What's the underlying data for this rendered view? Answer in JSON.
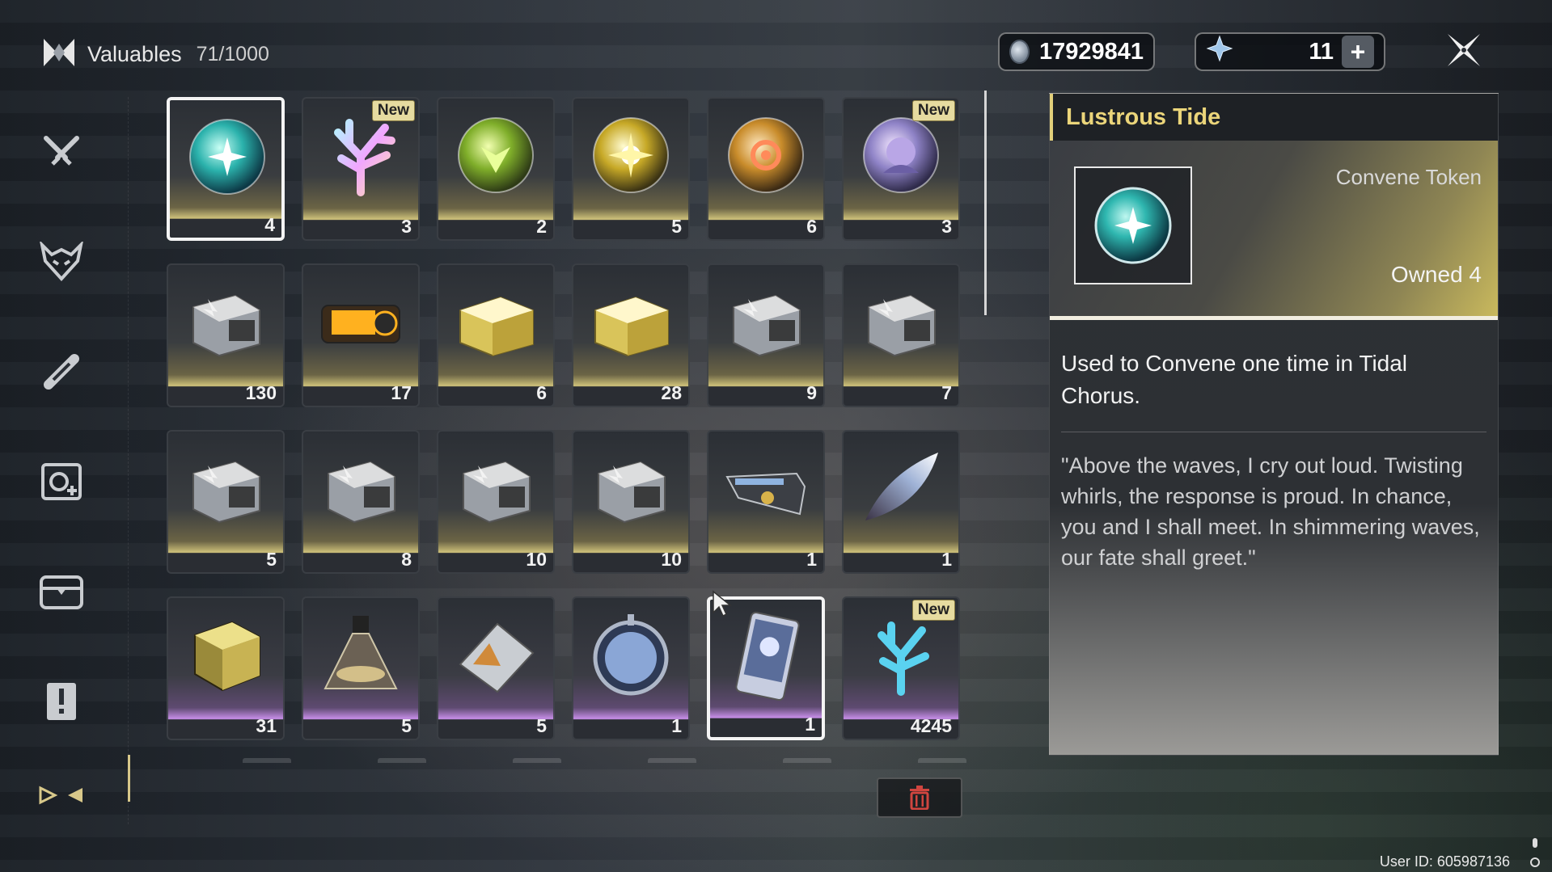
{
  "header": {
    "title": "Valuables",
    "capacity": "71/1000",
    "currency_primary": "17929841",
    "currency_secondary": "11"
  },
  "sidebar": {
    "items": [
      {
        "name": "weapons-tab",
        "icon": "crossed-swords-icon"
      },
      {
        "name": "echoes-tab",
        "icon": "demon-mask-icon"
      },
      {
        "name": "upgrade-materials-tab",
        "icon": "material-tab-icon"
      },
      {
        "name": "development-tab",
        "icon": "development-icon"
      },
      {
        "name": "supplies-tab",
        "icon": "chest-icon"
      },
      {
        "name": "quest-items-tab",
        "icon": "exclamation-icon"
      },
      {
        "name": "valuables-tab",
        "icon": "valuables-icon"
      }
    ]
  },
  "items": [
    {
      "name": "Lustrous Tide",
      "count": "4",
      "kind": "orb-teal",
      "new": "",
      "selected": true
    },
    {
      "name": "coral-pink",
      "count": "3",
      "kind": "coral-pink",
      "new": "New"
    },
    {
      "name": "orb-green",
      "count": "2",
      "kind": "orb-green",
      "new": ""
    },
    {
      "name": "orb-yellow",
      "count": "5",
      "kind": "orb-yellow",
      "new": ""
    },
    {
      "name": "orb-orange",
      "count": "6",
      "kind": "orb-orange",
      "new": ""
    },
    {
      "name": "character-orb",
      "count": "3",
      "kind": "orb-portrait",
      "new": "New"
    },
    {
      "name": "echo-crate",
      "count": "130",
      "kind": "crate-silver",
      "new": ""
    },
    {
      "name": "orange-crate",
      "count": "17",
      "kind": "crate-orange",
      "new": ""
    },
    {
      "name": "gold-chest-1",
      "count": "6",
      "kind": "chest-gold",
      "new": ""
    },
    {
      "name": "gold-chest-2",
      "count": "28",
      "kind": "chest-gold",
      "new": ""
    },
    {
      "name": "crate-9",
      "count": "9",
      "kind": "crate-silver",
      "new": ""
    },
    {
      "name": "crate-7",
      "count": "7",
      "kind": "crate-silver",
      "new": ""
    },
    {
      "name": "crate-5",
      "count": "5",
      "kind": "crate-silver",
      "new": ""
    },
    {
      "name": "crate-8",
      "count": "8",
      "kind": "crate-silver",
      "new": ""
    },
    {
      "name": "crate-10a",
      "count": "10",
      "kind": "crate-silver",
      "new": ""
    },
    {
      "name": "crate-10b",
      "count": "10",
      "kind": "crate-silver",
      "new": ""
    },
    {
      "name": "weapon-kit",
      "count": "1",
      "kind": "gun-kit",
      "new": ""
    },
    {
      "name": "feather-blade",
      "count": "1",
      "kind": "feather",
      "new": ""
    },
    {
      "name": "gold-cube",
      "count": "31",
      "kind": "gold-cube",
      "new": "",
      "rarity": "purple"
    },
    {
      "name": "flask",
      "count": "5",
      "kind": "flask",
      "new": "",
      "rarity": "purple"
    },
    {
      "name": "prism-case",
      "count": "5",
      "kind": "prism",
      "new": "",
      "rarity": "purple"
    },
    {
      "name": "emblem-medal",
      "count": "1",
      "kind": "medal",
      "new": "",
      "rarity": "purple"
    },
    {
      "name": "card-pass",
      "count": "1",
      "kind": "card",
      "new": "",
      "rarity": "purple",
      "selected": true
    },
    {
      "name": "coral-blue",
      "count": "4245",
      "kind": "coral-blue",
      "new": "New",
      "rarity": "purple"
    }
  ],
  "detail": {
    "title": "Lustrous Tide",
    "type": "Convene Token",
    "owned": "Owned 4",
    "description": "Used to Convene one time in Tidal Chorus.",
    "lore": "\"Above the waves, I cry out loud. Twisting whirls, the response is proud. In chance, you and I shall meet. In shimmering waves, our fate shall greet.\""
  },
  "footer": {
    "user_id": "User ID: 605987136"
  },
  "colors": {
    "accent_gold": "#e2cf7a",
    "rarity_gold": "#cfc27a",
    "rarity_purple": "#c78ee8",
    "delete_red": "#d0453f"
  }
}
